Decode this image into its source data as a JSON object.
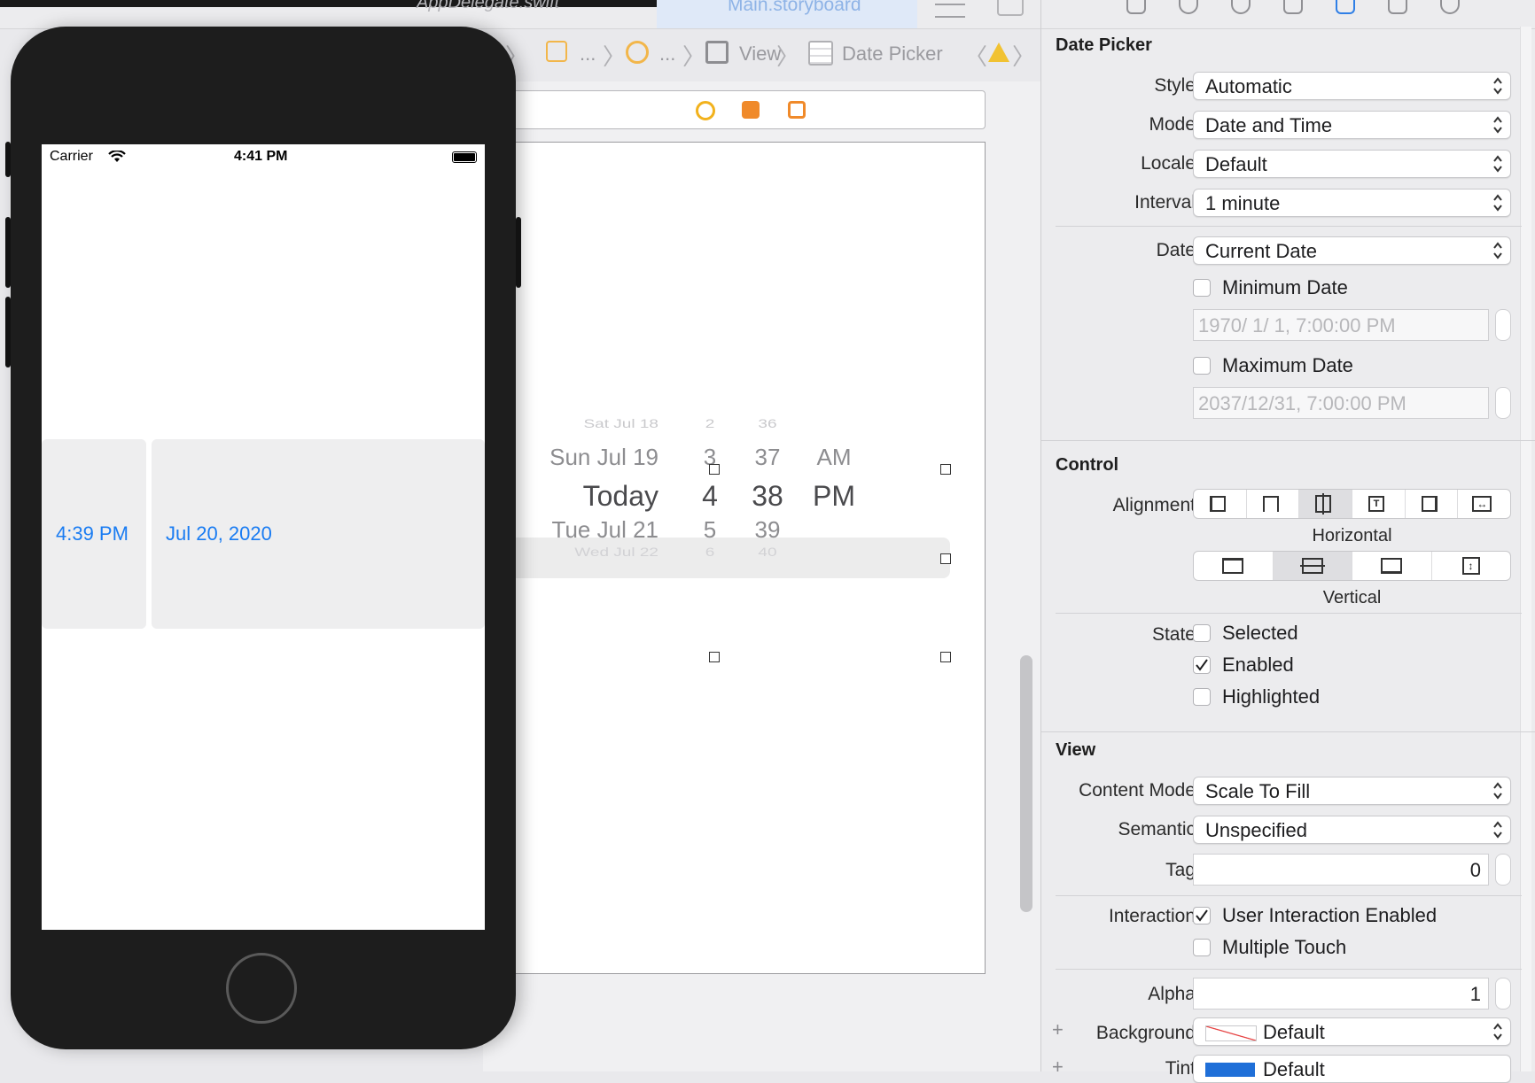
{
  "tabs": {
    "left_ghost": "AppDelegate.swift",
    "active": "Main.storyboard"
  },
  "breadcrumb": {
    "ellipsis_1": "...",
    "ellipsis_2": "...",
    "view": "View",
    "date_picker": "Date Picker"
  },
  "simulator": {
    "carrier": "Carrier",
    "time": "4:41 PM",
    "time_pill": "4:39 PM",
    "date_pill": "Jul 20, 2020"
  },
  "wheel": {
    "rows": [
      {
        "day": "Sat Jul 18",
        "hour": "2",
        "minute": "36",
        "ampm": ""
      },
      {
        "day": "Sun Jul 19",
        "hour": "3",
        "minute": "37",
        "ampm": "AM"
      },
      {
        "day": "Today",
        "hour": "4",
        "minute": "38",
        "ampm": "PM"
      },
      {
        "day": "Tue Jul 21",
        "hour": "5",
        "minute": "39",
        "ampm": ""
      },
      {
        "day": "Wed Jul 22",
        "hour": "6",
        "minute": "40",
        "ampm": ""
      }
    ]
  },
  "inspector": {
    "date_picker_title": "Date Picker",
    "style_label": "Style",
    "style_value": "Automatic",
    "mode_label": "Mode",
    "mode_value": "Date and Time",
    "locale_label": "Locale",
    "locale_value": "Default",
    "interval_label": "Interval",
    "interval_value": "1 minute",
    "date_label": "Date",
    "date_value": "Current Date",
    "min_date_label": "Minimum Date",
    "min_date_value": "1970/  1/  1,   7:00:00 PM",
    "max_date_label": "Maximum Date",
    "max_date_value": "2037/12/31,   7:00:00 PM",
    "control_title": "Control",
    "alignment_label": "Alignment",
    "horizontal_caption": "Horizontal",
    "vertical_caption": "Vertical",
    "state_label": "State",
    "selected_label": "Selected",
    "enabled_label": "Enabled",
    "highlighted_label": "Highlighted",
    "view_title": "View",
    "content_mode_label": "Content Mode",
    "content_mode_value": "Scale To Fill",
    "semantic_label": "Semantic",
    "semantic_value": "Unspecified",
    "tag_label": "Tag",
    "tag_value": "0",
    "interaction_label": "Interaction",
    "user_interaction_label": "User Interaction Enabled",
    "multiple_touch_label": "Multiple Touch",
    "alpha_label": "Alpha",
    "alpha_value": "1",
    "background_label": "Background",
    "background_value": "Default",
    "tint_label": "Tint",
    "tint_value": "Default"
  },
  "state": {
    "selected": false,
    "enabled": true,
    "highlighted": false,
    "minimum_date": false,
    "maximum_date": false,
    "user_interaction_enabled": true,
    "multiple_touch": false
  },
  "colors": {
    "accent": "#1a7cf2",
    "tint_swatch": "#1f6fd8",
    "phone_body": "#1d1d1d"
  }
}
